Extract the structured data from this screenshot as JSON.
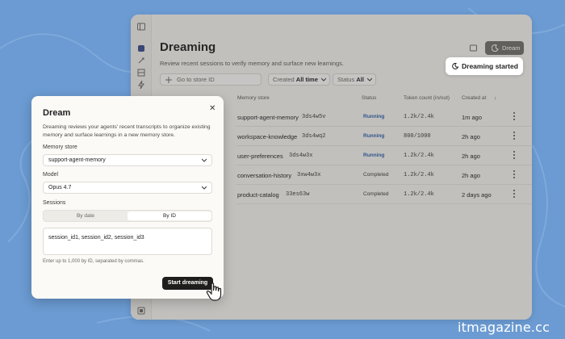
{
  "page": {
    "title": "Dreaming",
    "subtitle": "Review recent sessions to verify memory and surface new learnings.",
    "search_placeholder": "Go to store ID",
    "filters": [
      {
        "label": "Created",
        "value": "All time"
      },
      {
        "label": "Status",
        "value": "All"
      }
    ],
    "dream_button": "Dream"
  },
  "table": {
    "headers": [
      "Memory store",
      "Status",
      "Token count (in/out)",
      "Created at"
    ],
    "rows": [
      {
        "name": "support-agent-memory",
        "id": "3ds4w5v",
        "status": "Running",
        "tokens": "1.2k/2.4k",
        "created": "1m ago"
      },
      {
        "name": "workspace-knowledge",
        "id": "3ds4wq2",
        "status": "Running",
        "tokens": "800/1000",
        "created": "2h ago"
      },
      {
        "name": "user-preferences",
        "id": "3ds4w3x",
        "status": "Running",
        "tokens": "1.2k/2.4k",
        "created": "2h ago"
      },
      {
        "name": "conversation-history",
        "id": "3xw4w3x",
        "status": "Completed",
        "tokens": "1.2k/2.4k",
        "created": "2h ago"
      },
      {
        "name": "product-catalog",
        "id": "33es63w",
        "status": "Completed",
        "tokens": "1.2k/2.4k",
        "created": "2 days ago"
      }
    ]
  },
  "toast": {
    "text": "Dreaming started"
  },
  "modal": {
    "title": "Dream",
    "description": "Dreaming reviews your agents' recent transcripts to organize existing memory and surface learnings in a new memory store.",
    "memory_store_label": "Memory store",
    "memory_store_value": "support-agent-memory",
    "model_label": "Model",
    "model_value": "Opus 4.7",
    "sessions_label": "Sessions",
    "tabs": [
      "By date",
      "By ID"
    ],
    "sessions_value": "session_id1, session_id2, session_id3",
    "hint": "Enter up to 1,000 by ID, separated by commas.",
    "start_button": "Start dreaming"
  },
  "watermark": "itmagazine.cc",
  "colors": {
    "background": "#6b9bd2",
    "running": "#2f5ea8",
    "primary_button": "#1f1e1d"
  }
}
